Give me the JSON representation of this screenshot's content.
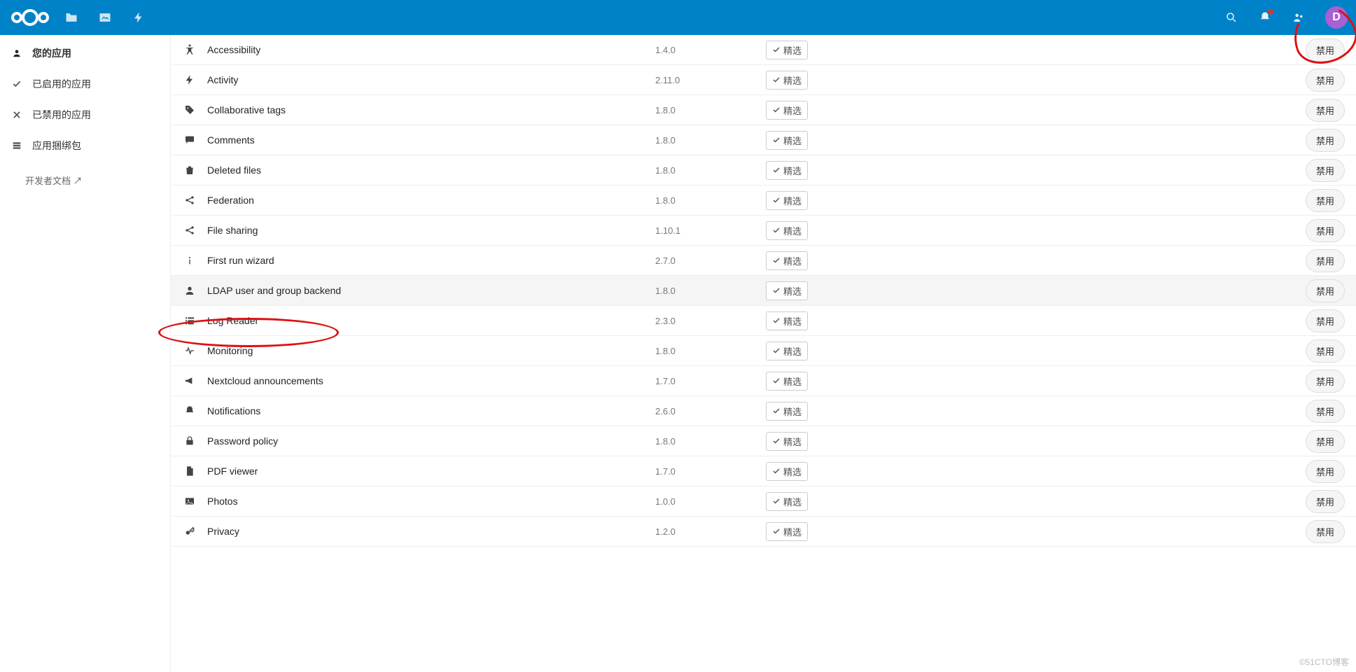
{
  "avatar_initial": "D",
  "sidebar": {
    "items": [
      {
        "label": "您的应用",
        "icon": "user"
      },
      {
        "label": "已启用的应用",
        "icon": "check"
      },
      {
        "label": "已禁用的应用",
        "icon": "close"
      },
      {
        "label": "应用捆绑包",
        "icon": "bundle"
      }
    ],
    "dev_docs": "开发者文档 ↗"
  },
  "badge_label": "精选",
  "action_label": "禁用",
  "apps": [
    {
      "name": "Accessibility",
      "version": "1.4.0",
      "icon": "accessibility"
    },
    {
      "name": "Activity",
      "version": "2.11.0",
      "icon": "activity"
    },
    {
      "name": "Collaborative tags",
      "version": "1.8.0",
      "icon": "tag"
    },
    {
      "name": "Comments",
      "version": "1.8.0",
      "icon": "comment"
    },
    {
      "name": "Deleted files",
      "version": "1.8.0",
      "icon": "trash"
    },
    {
      "name": "Federation",
      "version": "1.8.0",
      "icon": "share"
    },
    {
      "name": "File sharing",
      "version": "1.10.1",
      "icon": "share"
    },
    {
      "name": "First run wizard",
      "version": "2.7.0",
      "icon": "info"
    },
    {
      "name": "LDAP user and group backend",
      "version": "1.8.0",
      "icon": "user",
      "selected": true
    },
    {
      "name": "Log Reader",
      "version": "2.3.0",
      "icon": "list"
    },
    {
      "name": "Monitoring",
      "version": "1.8.0",
      "icon": "pulse"
    },
    {
      "name": "Nextcloud announcements",
      "version": "1.7.0",
      "icon": "megaphone"
    },
    {
      "name": "Notifications",
      "version": "2.6.0",
      "icon": "bell"
    },
    {
      "name": "Password policy",
      "version": "1.8.0",
      "icon": "lock"
    },
    {
      "name": "PDF viewer",
      "version": "1.7.0",
      "icon": "pdf"
    },
    {
      "name": "Photos",
      "version": "1.0.0",
      "icon": "image"
    },
    {
      "name": "Privacy",
      "version": "1.2.0",
      "icon": "key"
    }
  ],
  "watermark": "©51CTO博客"
}
